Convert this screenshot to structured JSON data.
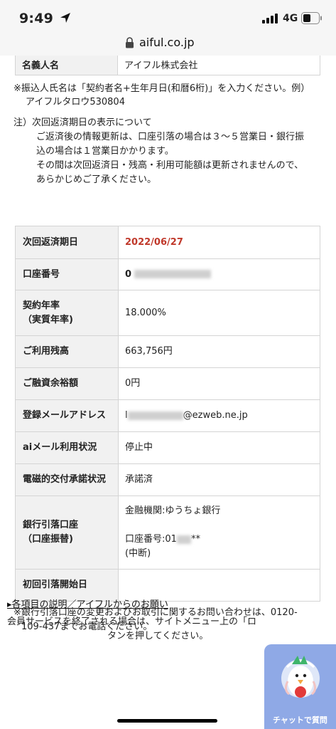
{
  "status_bar": {
    "time": "9:49",
    "network": "4G"
  },
  "browser": {
    "url": "aiful.co.jp"
  },
  "account_owner": {
    "label": "名義人名",
    "value": "アイフル株式会社"
  },
  "notes": {
    "transfer_name_line1": "※振込人氏名は「契約者名+生年月日(和暦6桁)」を入力ください。例）",
    "transfer_name_line2": "アイフルタロウ530804",
    "next_date_line1": "注）次回返済期日の表示について",
    "next_date_line2": "ご返済後の情報更新は、口座引落の場合は３～５営業日・銀行振",
    "next_date_line3": "込の場合は１営業日かかります。",
    "next_date_line4": "その間は次回返済日・残高・利用可能額は更新されませんので、",
    "next_date_line5": "あらかじめご了承ください。"
  },
  "table": {
    "next_payment_label": "次回返済期日",
    "next_payment_value": "2022/06/27",
    "account_number_label": "口座番号",
    "account_number_visible": "0",
    "rate_label_line1": "契約年率",
    "rate_label_line2": "（実質年率)",
    "rate_value": "18.000%",
    "balance_label": "ご利用残高",
    "balance_value": "663,756円",
    "available_label": "ご融資余裕額",
    "available_value": "0円",
    "email_label": "登録メールアドレス",
    "email_prefix": "l",
    "email_domain": "@ezweb.ne.jp",
    "aimail_label": "aiメール利用状況",
    "aimail_value": "停止中",
    "electronic_label": "電磁的交付承諾状況",
    "electronic_value": "承諾済",
    "bank_label_line1": "銀行引落口座",
    "bank_label_line2": "（口座振替)",
    "bank_institution": "金融機関:ゆうちょ銀行",
    "bank_account_prefix": "口座番号:01",
    "bank_account_suffix": "**",
    "bank_status": "(中断)",
    "first_debit_label": "初回引落開始日",
    "first_debit_value": ""
  },
  "contact_note": {
    "line1": "※銀行引落口座の変更およびお取引に関するお問い合わせは、0120-",
    "line2": "109-437までお電話ください。"
  },
  "bottom": {
    "link_text": "▸各項目の説明／アイフルからのお願い",
    "text_line1": "会員サービスを終了される場合は、サイトメニュー上の「ロ",
    "text_line2": "タンを押してください。"
  },
  "chat": {
    "label": "チャットで質問"
  },
  "colors": {
    "accent_red": "#c0392b",
    "label_bg": "#f1f1f1",
    "border": "#d4d4d4",
    "chat_bg": "#8fa9e6"
  },
  "icons": [
    "location-arrow-icon",
    "signal-icon",
    "battery-icon",
    "lock-icon",
    "chat-bird-icon"
  ]
}
